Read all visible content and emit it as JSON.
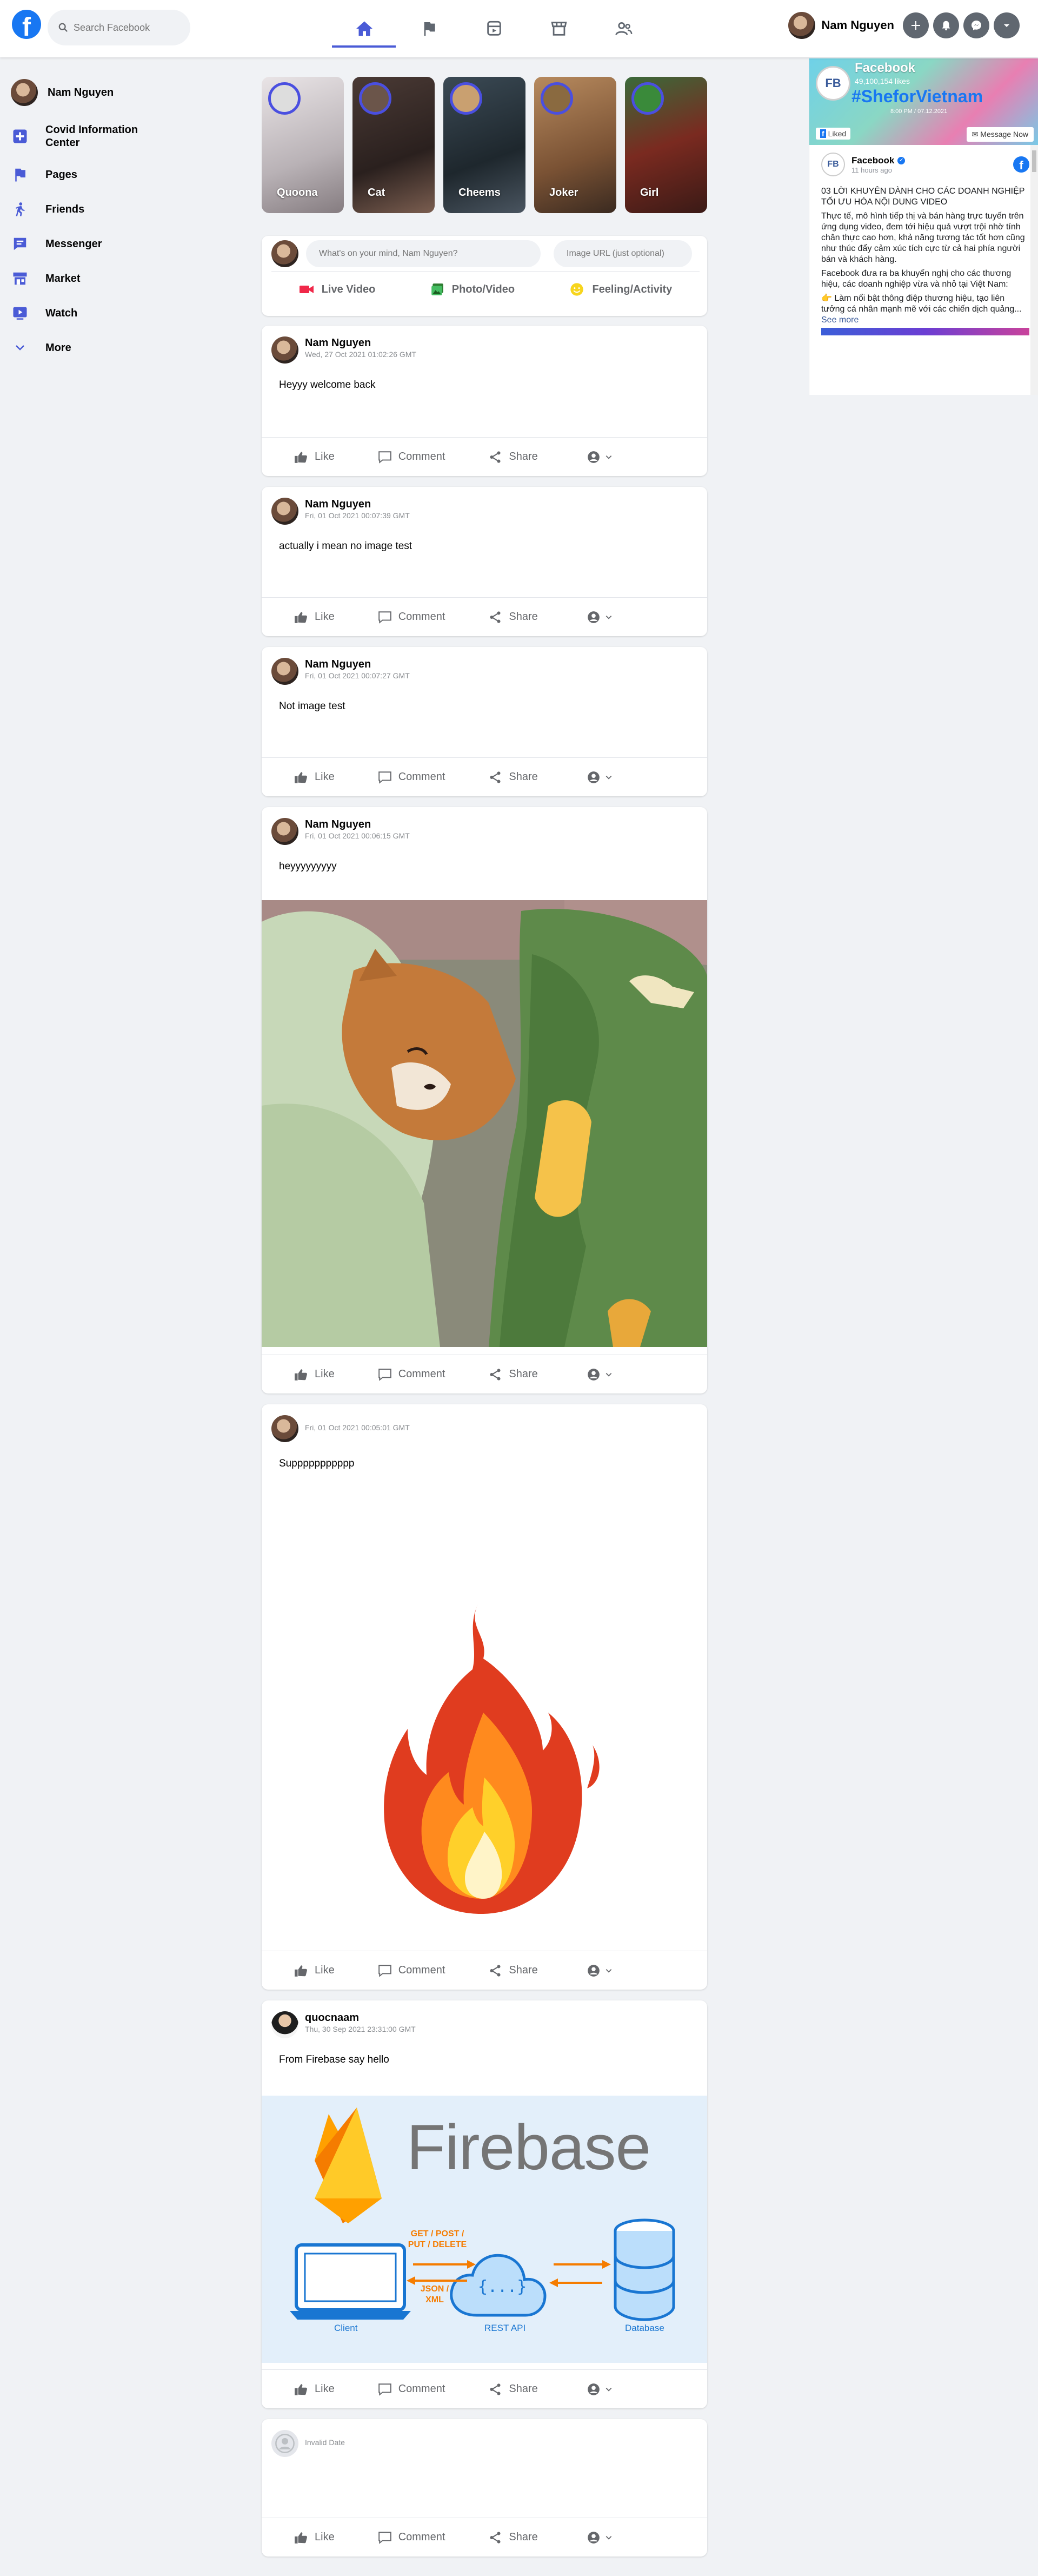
{
  "header": {
    "logo": "f",
    "search_placeholder": "Search Facebook",
    "user_name": "Nam Nguyen",
    "nav_icons": [
      "home-icon",
      "flag-icon",
      "video-icon",
      "marketplace-icon",
      "groups-icon"
    ],
    "accent": "#4a5bd6"
  },
  "sidebar": {
    "profile_name": "Nam Nguyen",
    "items": [
      {
        "label": "Covid Information Center",
        "icon": "covid-plus-icon"
      },
      {
        "label": "Pages",
        "icon": "flag-icon"
      },
      {
        "label": "Friends",
        "icon": "friends-icon"
      },
      {
        "label": "Messenger",
        "icon": "messenger-icon"
      },
      {
        "label": "Market",
        "icon": "marketplace-icon"
      },
      {
        "label": "Watch",
        "icon": "watch-icon"
      },
      {
        "label": "More",
        "icon": "chevron-down-icon"
      }
    ]
  },
  "stories": [
    {
      "name": "Quoona",
      "bg": "#c9c3c8"
    },
    {
      "name": "Cat",
      "bg": "#3a2d2a"
    },
    {
      "name": "Cheems",
      "bg": "#2c3a40"
    },
    {
      "name": "Joker",
      "bg": "#8a5a3a"
    },
    {
      "name": "Girl",
      "bg": "#5a2a24"
    }
  ],
  "composer": {
    "text_placeholder": "What's on your mind, Nam Nguyen?",
    "image_placeholder": "Image URL (just optional)",
    "actions": [
      "Live Video",
      "Photo/Video",
      "Feeling/Activity"
    ]
  },
  "post_actions": {
    "like": "Like",
    "comment": "Comment",
    "share": "Share"
  },
  "posts": [
    {
      "author": "Nam Nguyen",
      "time": "Wed, 27 Oct 2021 01:02:26 GMT",
      "text": "Heyyy welcome back"
    },
    {
      "author": "Nam Nguyen",
      "time": "Fri, 01 Oct 2021 00:07:39 GMT",
      "text": "actually i mean no image test"
    },
    {
      "author": "Nam Nguyen",
      "time": "Fri, 01 Oct 2021 00:07:27 GMT",
      "text": "Not image test"
    },
    {
      "author": "Nam Nguyen",
      "time": "Fri, 01 Oct 2021 00:06:15 GMT",
      "text": "heyyyyyyyyy"
    },
    {
      "author": "",
      "time": "Fri, 01 Oct 2021 00:05:01 GMT",
      "text": "Suppppppppppp"
    },
    {
      "author": "quocnaam",
      "time": "Thu, 30 Sep 2021 23:31:00 GMT",
      "text": "From Firebase say hello",
      "image": {
        "title": "Firebase",
        "get_label": "GET / POST / PUT / DELETE",
        "json_label": "JSON / XML",
        "client": "Client",
        "api": "REST API",
        "db": "Database"
      }
    },
    {
      "author": "",
      "time": "Invalid Date",
      "text": ""
    }
  ],
  "right_panel": {
    "page_name": "Facebook",
    "likes": "49,100,154 likes",
    "hashtag": "#SheforVietnam",
    "cover_date": "8:00 PM / 07.12.2021",
    "avatar_text": "FB",
    "liked": "Liked",
    "message": "Message Now",
    "post_author": "Facebook",
    "post_time": "11 hours ago",
    "p1": "03 LỜI KHUYÊN DÀNH CHO CÁC DOANH NGHIỆP TỐI ƯU HÓA NỘI DUNG VIDEO",
    "p2": "Thực tế, mô hình tiếp thị và bán hàng trực tuyến trên ứng dụng video, đem tới hiệu quả vượt trội nhờ tính chân thực cao hơn, khả năng tương tác tốt hơn cũng như thúc đẩy cảm xúc tích cực từ cả hai phía người bán và khách hàng.",
    "p3": "Facebook đưa ra ba khuyến nghị cho các thương hiệu, các doanh nghiệp vừa và nhỏ tại Việt Nam:",
    "p4": "👉 Làm nổi bật thông điệp thương hiệu, tạo liên tưởng cá nhân mạnh mẽ với các chiến dịch quảng...",
    "see_more": "See more"
  }
}
